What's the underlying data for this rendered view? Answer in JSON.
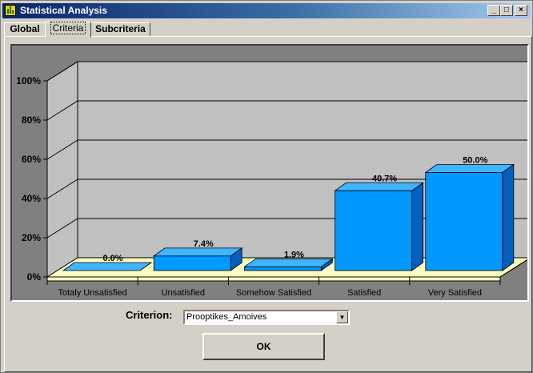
{
  "window": {
    "title": "Statistical Analysis",
    "controls": {
      "minimize": "_",
      "maximize": "□",
      "close": "×"
    }
  },
  "tabs": [
    {
      "label": "Global",
      "active": false
    },
    {
      "label": "Criteria",
      "active": true
    },
    {
      "label": "Subcriteria",
      "active": false
    }
  ],
  "chart_data": {
    "type": "bar",
    "categories": [
      "Totaly Unsatisfied",
      "Unsatisfied",
      "Somehow Satisfied",
      "Satisfied",
      "Very Satisfied"
    ],
    "values": [
      0.0,
      7.4,
      1.9,
      40.7,
      50.0
    ],
    "data_labels": [
      "0.0%",
      "7.4%",
      "1.9%",
      "40.7%",
      "50.0%"
    ],
    "y_ticks": [
      "0%",
      "20%",
      "40%",
      "60%",
      "80%",
      "100%"
    ],
    "ylim": [
      0,
      100
    ],
    "grid": true,
    "style": "3d",
    "colors": {
      "bar": "#0099ff",
      "floor": "#ffffc0",
      "wall": "#c0c0c0",
      "background": "#808080"
    }
  },
  "criterion": {
    "label": "Criterion:",
    "selected": "Prooptikes_Amoives"
  },
  "ok_button": "OK"
}
